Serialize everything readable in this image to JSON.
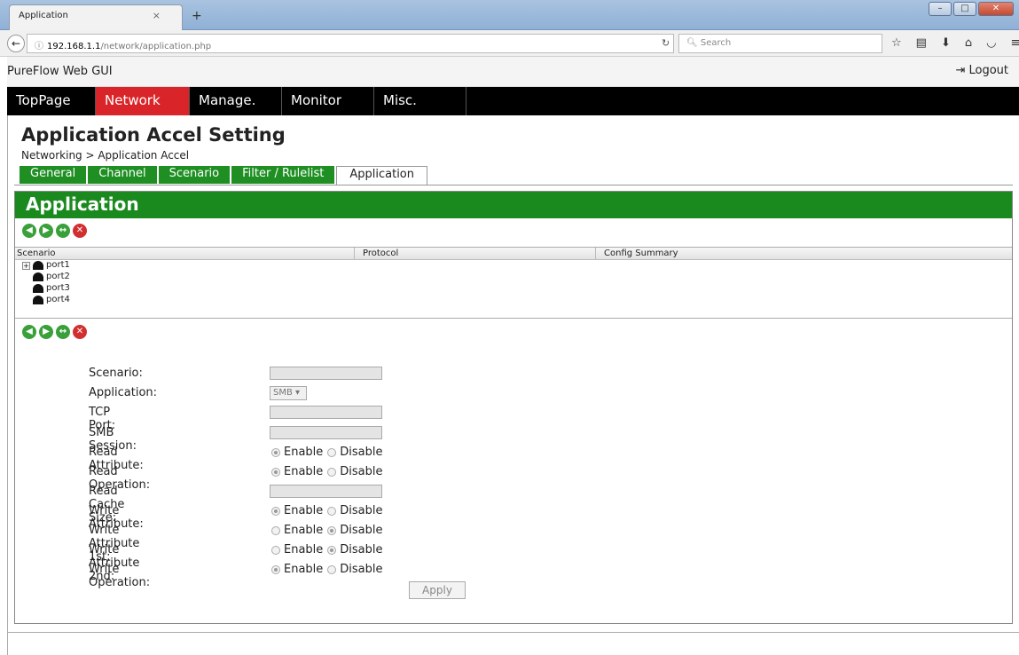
{
  "browser": {
    "tab_title": "Application",
    "tab_close": "×",
    "new_tab": "+",
    "url_host": "192.168.1.1",
    "url_path": "/network/application.php",
    "search_placeholder": "Search"
  },
  "app": {
    "brand": "PureFlow Web GUI",
    "logout": "Logout"
  },
  "menu": {
    "items": [
      {
        "label": "TopPage"
      },
      {
        "label": "Network"
      },
      {
        "label": "Manage."
      },
      {
        "label": "Monitor"
      },
      {
        "label": "Misc."
      }
    ],
    "active": "Network"
  },
  "page": {
    "title": "Application Accel Setting",
    "breadcrumb": "Networking > Application Accel"
  },
  "subtabs": [
    "General",
    "Channel",
    "Scenario",
    "Filter / Rulelist",
    "Application"
  ],
  "panel": {
    "title": "Application",
    "grid_headers": [
      "Scenario",
      "Protocol",
      "Config Summary"
    ],
    "tree": [
      "port1",
      "port2",
      "port3",
      "port4"
    ]
  },
  "form": {
    "scenario_label": "Scenario:",
    "application_label": "Application:",
    "application_value": "SMB",
    "tcp_port_label": "TCP Port:",
    "smb_session_label": "SMB Session:",
    "read_attribute_label": "Read Attribute:",
    "read_operation_label": "Read Operation:",
    "read_cache_size_label": "Read Cache Size:",
    "write_attribute_label": "Write Attribute:",
    "write_attribute_1st_label": "Write Attribute 1st:",
    "write_attribute_2nd_label": "Write Attribute 2nd:",
    "write_operation_label": "Write Operation:",
    "enable": "Enable",
    "disable": "Disable",
    "apply": "Apply"
  },
  "colors": {
    "menu_active": "#d9252a",
    "tab_green": "#1f8f24",
    "panel_header": "#1a8a1f"
  }
}
